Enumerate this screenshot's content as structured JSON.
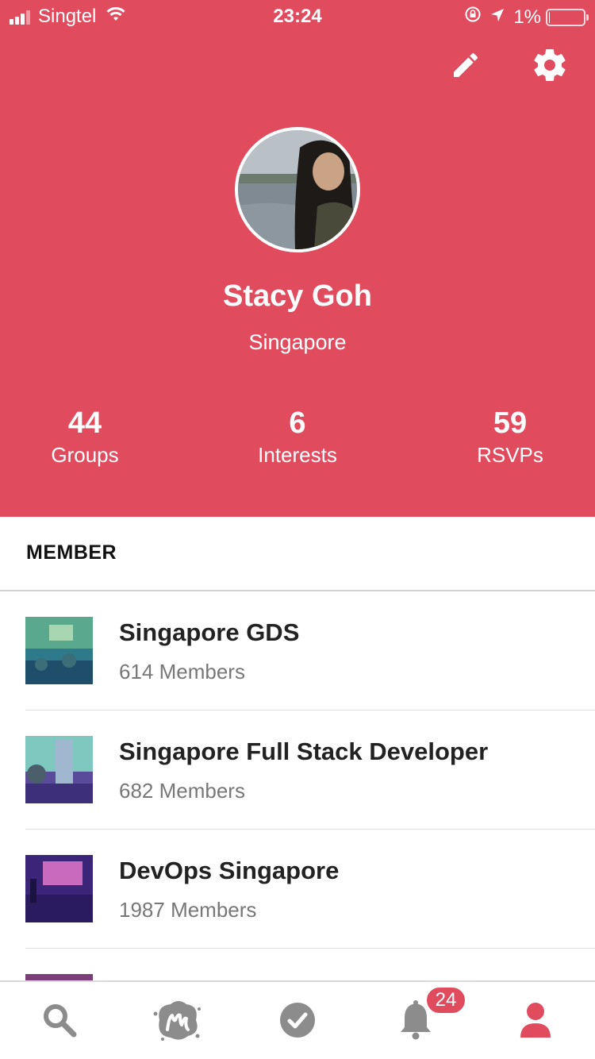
{
  "status_bar": {
    "carrier": "Singtel",
    "time": "23:24",
    "battery": "1%",
    "battery_level": 0.01
  },
  "profile": {
    "name": "Stacy Goh",
    "location": "Singapore"
  },
  "stats": [
    {
      "value": "44",
      "label": "Groups"
    },
    {
      "value": "6",
      "label": "Interests"
    },
    {
      "value": "59",
      "label": "RSVPs"
    }
  ],
  "section": {
    "title": "MEMBER"
  },
  "groups": [
    {
      "name": "Singapore GDS",
      "members": "614 Members"
    },
    {
      "name": "Singapore Full Stack Developer",
      "members": "682 Members"
    },
    {
      "name": "DevOps Singapore",
      "members": "1987 Members"
    },
    {
      "name": "",
      "members": ""
    }
  ],
  "tabbar": {
    "notification_count": "24",
    "icons": [
      "search-icon",
      "meetup-icon",
      "check-icon",
      "bell-icon",
      "profile-icon"
    ]
  },
  "colors": {
    "brand": "#e04c5e",
    "active_tab": "#e04c5e",
    "inactive_tab": "#8c8c8c"
  }
}
